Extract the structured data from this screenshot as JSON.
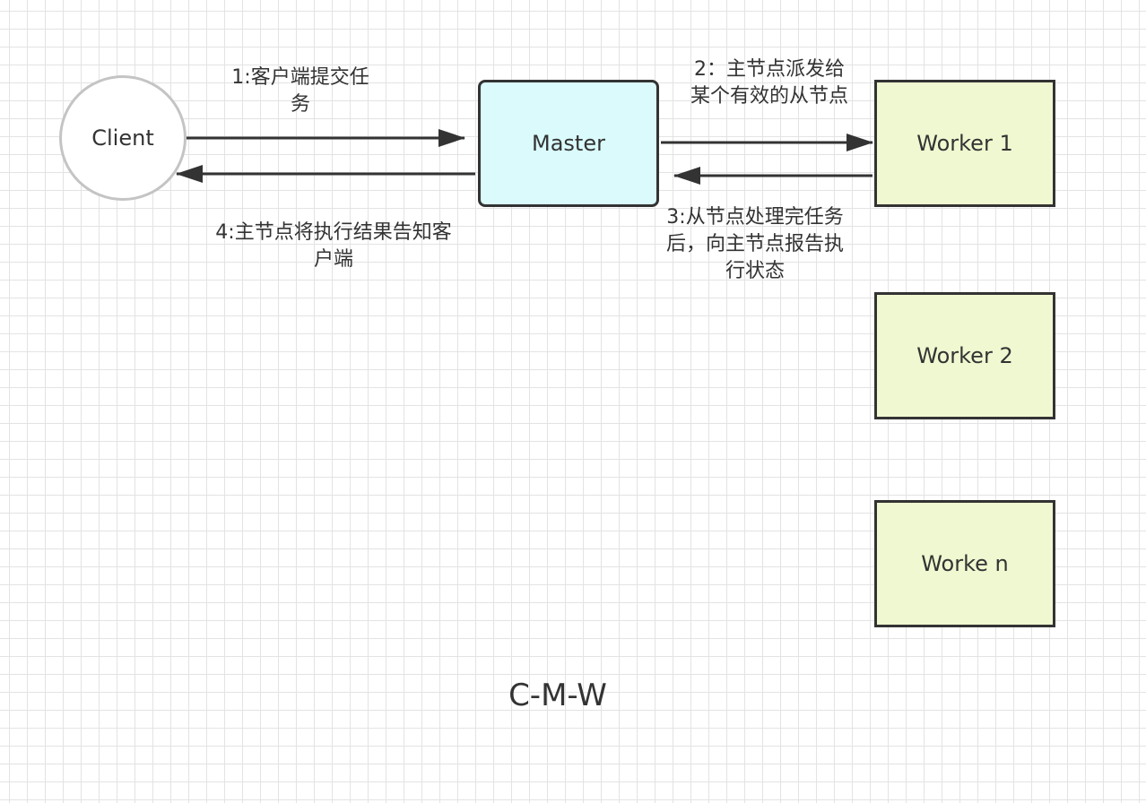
{
  "nodes": {
    "client": "Client",
    "master": "Master",
    "worker1": "Worker 1",
    "worker2": "Worker 2",
    "workern": "Worke n"
  },
  "edge_labels": {
    "step1_line1": "1:客户端提交任",
    "step1_line2": "务",
    "step2_line1": "2：主节点派发给",
    "step2_line2": "某个有效的从节点",
    "step3_line1": "3:从节点处理完任务",
    "step3_line2": "后，向主节点报告执",
    "step3_line3": "行状态",
    "step4_line1": "4:主节点将执行结果告知客",
    "step4_line2": "户端"
  },
  "caption": "C-M-W",
  "colors": {
    "master_fill": "#dafafb",
    "worker_fill": "#eff8d0",
    "client_border": "#c4c4c4",
    "stroke": "#333333",
    "grid": "#e3e3e3"
  }
}
